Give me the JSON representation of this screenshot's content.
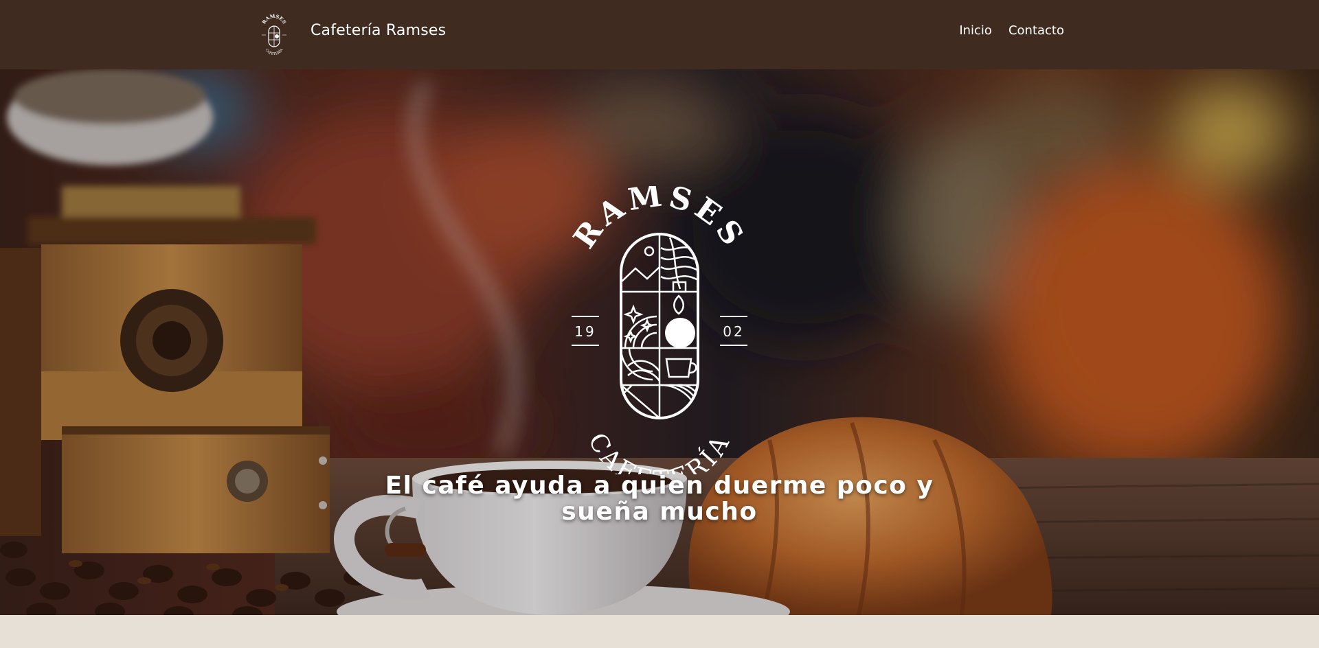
{
  "navbar": {
    "brand_name": "Cafetería Ramses",
    "links": [
      {
        "label": "Inicio"
      },
      {
        "label": "Contacto"
      }
    ],
    "background_color": "#3f2b1f"
  },
  "logo": {
    "top_word": "RAMSES",
    "bottom_word": "CAFETERÍA",
    "year_left": "19",
    "year_right": "02"
  },
  "hero": {
    "quote": "El café ayuda a quien duerme poco y sueña mucho"
  }
}
